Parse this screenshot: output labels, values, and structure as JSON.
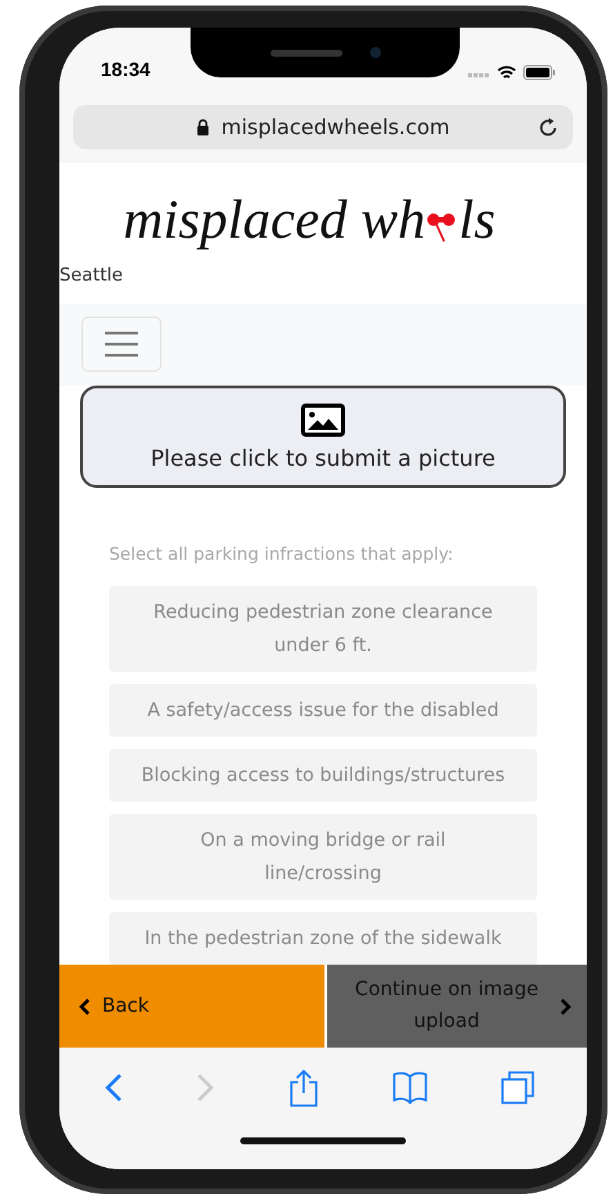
{
  "status_bar": {
    "time": "18:34"
  },
  "address_bar": {
    "url": "misplacedwheels.com"
  },
  "logo": {
    "text_before": "misplaced wh",
    "text_after": "ls"
  },
  "city": "Seattle",
  "upload_button": {
    "label": "Please click to submit a picture"
  },
  "instruction": "Select all parking infractions that apply:",
  "infractions": [
    {
      "label": "Reducing pedestrian zone clearance under 6 ft.",
      "disabled": true
    },
    {
      "label": "A safety/access issue for the disabled",
      "disabled": true
    },
    {
      "label": "Blocking access to buildings/structures",
      "disabled": true
    },
    {
      "label": "On a moving bridge or rail line/crossing",
      "disabled": true
    },
    {
      "label": "In the pedestrian zone of the sidewalk",
      "disabled": true
    }
  ],
  "back_button": {
    "label": "Back"
  },
  "continue_button": {
    "label": "Continue on image upload"
  },
  "browser_toolbar": {
    "back_disabled": false,
    "forward_disabled": true
  }
}
